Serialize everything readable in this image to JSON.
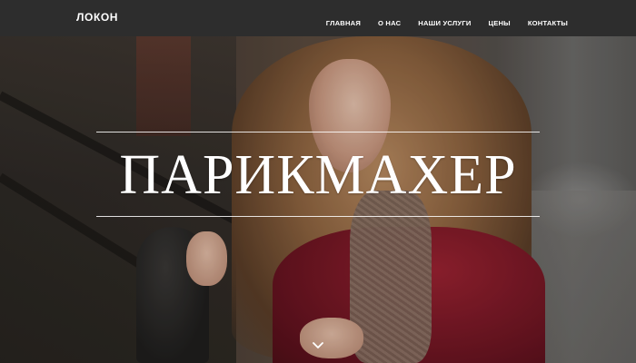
{
  "header": {
    "brand": "ЛОКОН",
    "nav": [
      {
        "label": "ГЛАВНАЯ"
      },
      {
        "label": "О НАС"
      },
      {
        "label": "НАШИ УСЛУГИ"
      },
      {
        "label": "ЦЕНЫ"
      },
      {
        "label": "КОНТАКТЫ"
      }
    ]
  },
  "hero": {
    "headline": "ПАРИКМАХЕР",
    "scroll_icon": "chevron-down-icon",
    "text_color": "#ffffff",
    "navbar_color": "#2d2d2d"
  }
}
